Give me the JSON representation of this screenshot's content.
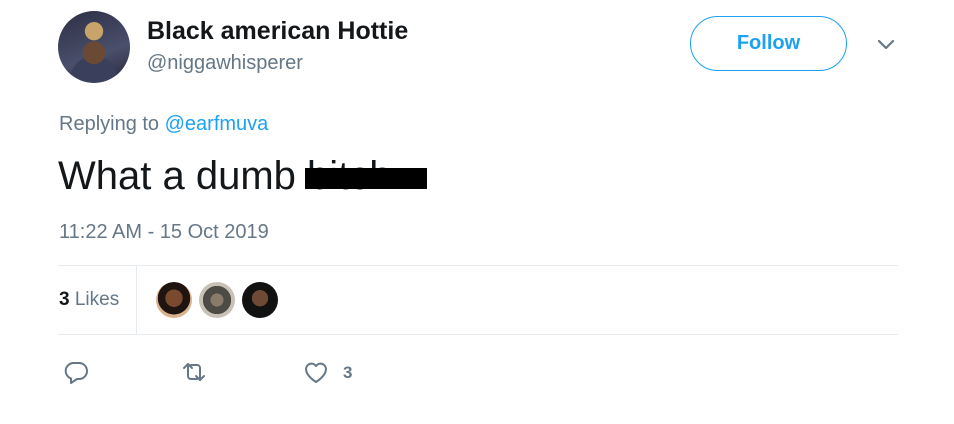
{
  "user": {
    "display_name": "Black american Hottie",
    "handle": "@niggawhisperer"
  },
  "header": {
    "follow_label": "Follow"
  },
  "tweet": {
    "replying_prefix": "Replying to",
    "replying_to": "@earfmuva",
    "text": "What a dumb bitch",
    "timestamp": "11:22 AM - 15 Oct 2019"
  },
  "stats": {
    "likes_count": "3",
    "likes_label": "Likes"
  },
  "actions": {
    "like_count": "3"
  },
  "colors": {
    "accent": "#1da1f2",
    "muted": "#657786",
    "text": "#14171a",
    "divider": "#e6ecf0"
  },
  "icons": [
    "reply-icon",
    "retweet-icon",
    "heart-icon",
    "chevron-down-icon"
  ]
}
